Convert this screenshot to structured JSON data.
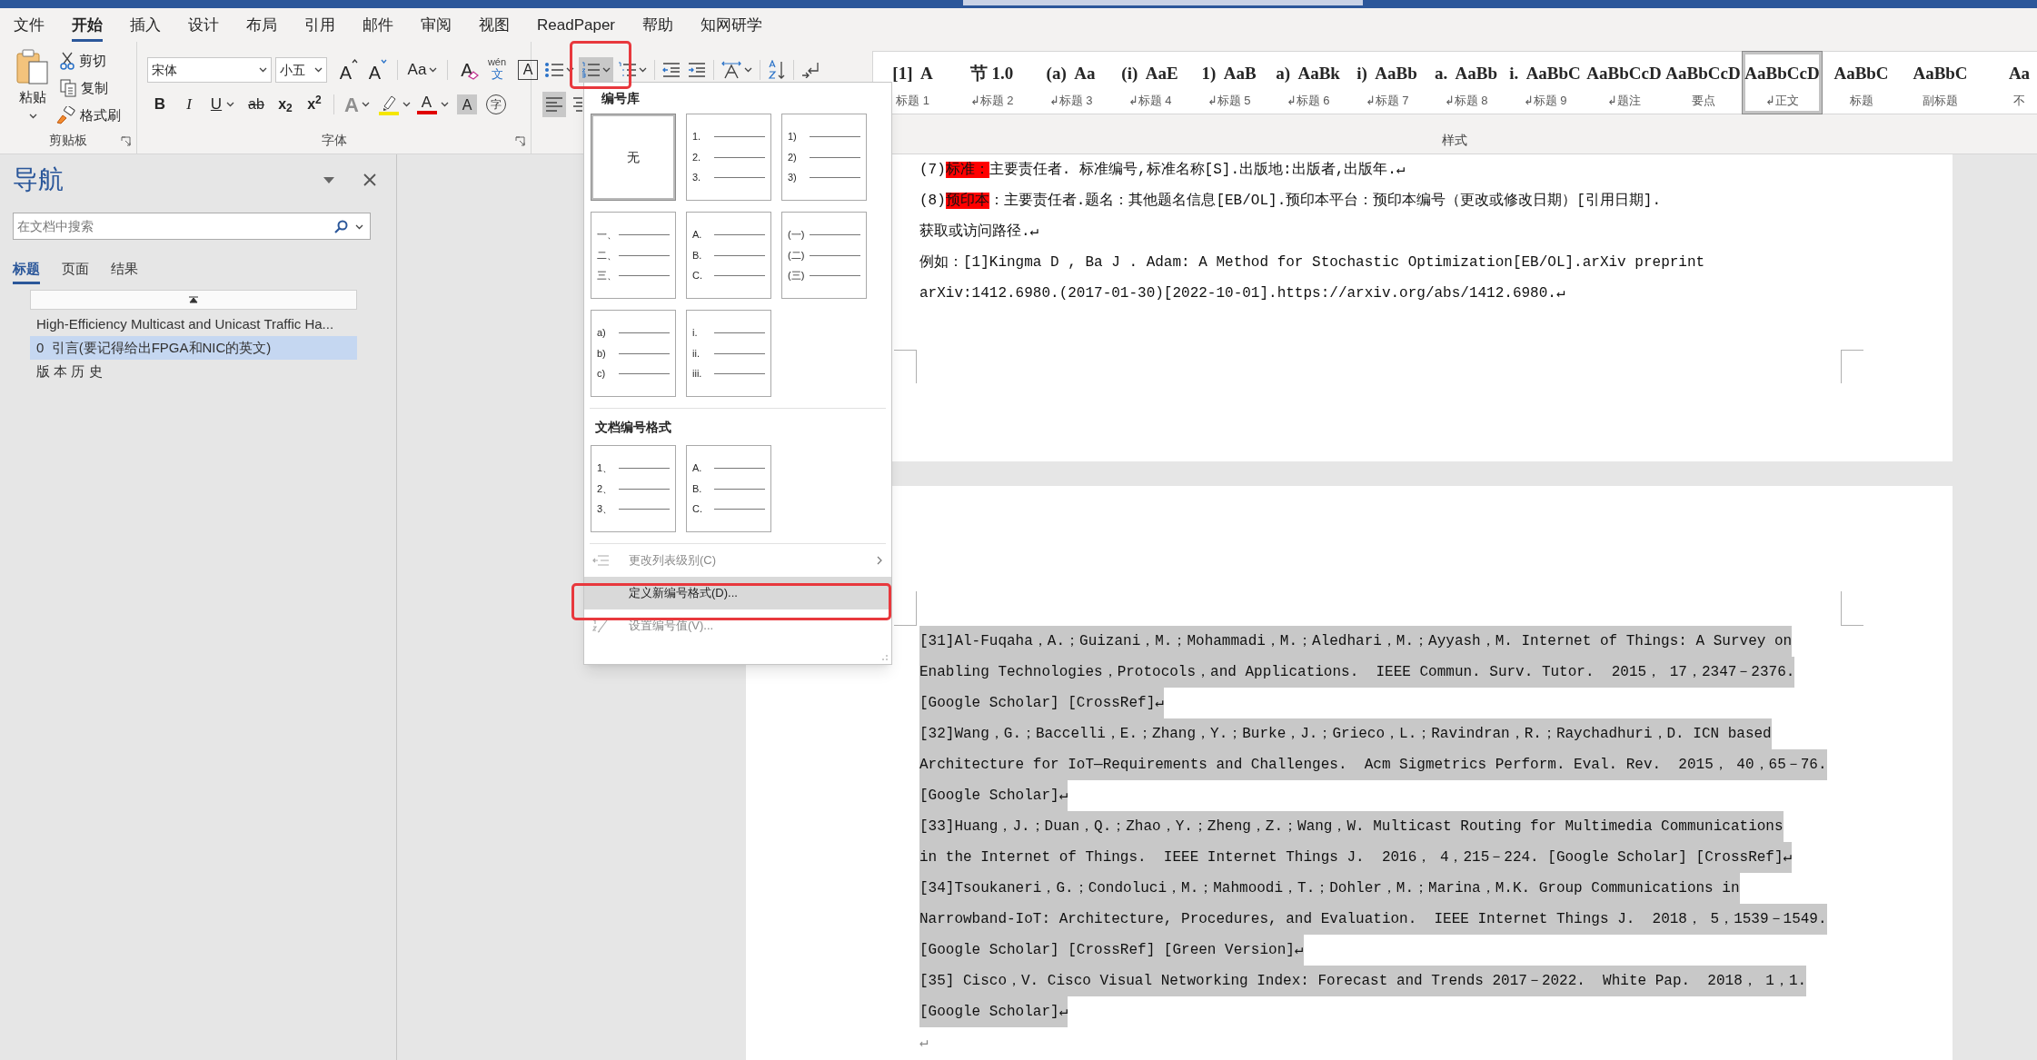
{
  "menu_tabs": [
    {
      "label": "文件",
      "selected": false
    },
    {
      "label": "开始",
      "selected": true
    },
    {
      "label": "插入",
      "selected": false
    },
    {
      "label": "设计",
      "selected": false
    },
    {
      "label": "布局",
      "selected": false
    },
    {
      "label": "引用",
      "selected": false
    },
    {
      "label": "邮件",
      "selected": false
    },
    {
      "label": "审阅",
      "selected": false
    },
    {
      "label": "视图",
      "selected": false
    },
    {
      "label": "ReadPaper",
      "selected": false
    },
    {
      "label": "帮助",
      "selected": false
    },
    {
      "label": "知网研学",
      "selected": false
    }
  ],
  "clipboard": {
    "paste": "粘贴",
    "cut": "剪切",
    "copy": "复制",
    "format_painter": "格式刷",
    "group_label": "剪贴板"
  },
  "font": {
    "font_name": "宋体",
    "font_size": "小五",
    "group_label": "字体",
    "row1": [
      {
        "kind": "grow",
        "glyph": "A"
      },
      {
        "kind": "shrink",
        "glyph": "A"
      },
      {
        "kind": "case",
        "glyph": "Aa"
      },
      {
        "kind": "clear",
        "glyph": "A"
      },
      {
        "kind": "phonetic",
        "glyph": "wén",
        "sub": "文"
      },
      {
        "kind": "border",
        "glyph": "A"
      }
    ],
    "row2": [
      {
        "kind": "bold",
        "glyph": "B"
      },
      {
        "kind": "italic",
        "glyph": "I"
      },
      {
        "kind": "underline",
        "glyph": "U"
      },
      {
        "kind": "strike",
        "glyph": "ab"
      },
      {
        "kind": "script",
        "glyph": "x$_{2}$"
      },
      {
        "kind": "script",
        "glyph": "x$^{2}$"
      },
      {
        "kind": "effects",
        "glyph": "A"
      },
      {
        "kind": "highlight"
      },
      {
        "kind": "color",
        "glyph": "A"
      },
      {
        "kind": "shading",
        "glyph": "A"
      },
      {
        "kind": "enclose",
        "glyph": "字"
      }
    ]
  },
  "paragraph": {
    "row1": [
      {
        "kind": "bullets",
        "selected": false
      },
      {
        "kind": "numbering",
        "selected": true
      },
      {
        "kind": "multilevel",
        "selected": false
      },
      {
        "kind": "outdent",
        "selected": false
      },
      {
        "kind": "indent",
        "selected": false
      },
      {
        "kind": "direction",
        "selected": false
      },
      {
        "kind": "sort",
        "selected": false
      },
      {
        "kind": "marks",
        "selected": false
      }
    ],
    "row2": [
      {
        "kind": "align_left",
        "selected": true
      },
      {
        "kind": "align_center",
        "selected": false
      }
    ]
  },
  "styles": {
    "group_label": "样式",
    "items": [
      {
        "preview": "[1]  A",
        "label": "标题 1",
        "selected": false
      },
      {
        "preview": "节 1.0",
        "label": "↲标题 2",
        "selected": false
      },
      {
        "preview": "(a)  Aa",
        "label": "↲标题 3",
        "selected": false
      },
      {
        "preview": "(i)  AaE",
        "label": "↲标题 4",
        "selected": false
      },
      {
        "preview": "1)  AaB",
        "label": "↲标题 5",
        "selected": false
      },
      {
        "preview": "a)  AaBk",
        "label": "↲标题 6",
        "selected": false
      },
      {
        "preview": "i)  AaBb",
        "label": "↲标题 7",
        "selected": false
      },
      {
        "preview": "a.  AaBb",
        "label": "↲标题 8",
        "selected": false
      },
      {
        "preview": "i.  AaBbC",
        "label": "↲标题 9",
        "selected": false
      },
      {
        "preview": "AaBbCcD",
        "label": "↲题注",
        "selected": false
      },
      {
        "preview": "AaBbCcD",
        "label": "要点",
        "selected": false
      },
      {
        "preview": "AaBbCcD",
        "label": "↲正文",
        "selected": true
      },
      {
        "preview": "AaBbC",
        "label": "标题",
        "selected": false
      },
      {
        "preview": "AaBbC",
        "label": "副标题",
        "selected": false
      },
      {
        "preview": "Aa",
        "label": "不",
        "selected": false
      }
    ]
  },
  "navigation": {
    "title": "导航",
    "search": {
      "placeholder": "在文档中搜索"
    },
    "tabs": [
      {
        "label": "标题",
        "selected": true
      },
      {
        "label": "页面",
        "selected": false
      },
      {
        "label": "结果",
        "selected": false
      }
    ],
    "headings": [
      {
        "label": "High-Efficiency Multicast and Unicast Traffic Ha...",
        "selected": false
      },
      {
        "label": "0  引言(要记得给出FPGA和NIC的英文)",
        "selected": true
      },
      {
        "label": "版 本 历 史",
        "selected": false
      }
    ]
  },
  "numbering_menu": {
    "library_title": "编号库",
    "library": [
      {
        "kind": "none",
        "label": "无",
        "selected": true
      },
      {
        "kind": "list",
        "labels": [
          "1.",
          "2.",
          "3."
        ],
        "selected": false
      },
      {
        "kind": "list",
        "labels": [
          "1)",
          "2)",
          "3)"
        ],
        "selected": false
      },
      {
        "kind": "list",
        "labels": [
          "一、",
          "二、",
          "三、"
        ],
        "selected": false
      },
      {
        "kind": "list",
        "labels": [
          "A.",
          "B.",
          "C."
        ],
        "selected": false
      },
      {
        "kind": "list",
        "labels": [
          "(一)",
          "(二)",
          "(三)"
        ],
        "selected": false
      },
      {
        "kind": "list",
        "labels": [
          "a)",
          "b)",
          "c)"
        ],
        "selected": false
      },
      {
        "kind": "list",
        "labels": [
          "i.",
          "ii.",
          "iii."
        ],
        "selected": false
      }
    ],
    "document_title": "文档编号格式",
    "document_formats": [
      {
        "kind": "list",
        "labels": [
          "1、",
          "2、",
          "3、"
        ],
        "selected": false
      },
      {
        "kind": "list",
        "labels": [
          "A.",
          "B.",
          "C."
        ],
        "selected": false
      }
    ],
    "commands": [
      {
        "kind": "level",
        "label": "更改列表级别(C)",
        "disabled": true,
        "highlighted": false,
        "submenu": true
      },
      {
        "kind": "define",
        "label": "定义新编号格式(D)...",
        "disabled": false,
        "highlighted": true,
        "submenu": false
      },
      {
        "kind": "value",
        "label": "设置编号值(V)...",
        "disabled": true,
        "highlighted": false,
        "submenu": false
      }
    ]
  },
  "document": {
    "page_1": [
      {
        "kind": "entry",
        "number": "(7)",
        "tag": "标准：",
        "text": "主要责任者. 标准编号,标准名称[S].出版地:出版者,出版年.↵"
      },
      {
        "kind": "entry",
        "number": "(8)",
        "tag": "预印本",
        "text": "：主要责任者.题名：其他题名信息[EB/OL].预印本平台：预印本编号（更改或修改日期）[引用日期]."
      },
      {
        "kind": "plain",
        "text": "获取或访问路径.↵"
      },
      {
        "kind": "plain",
        "text": "例如：[1]Kingma D , Ba J . Adam: A Method for Stochastic Optimization[EB/OL].arXiv preprint"
      },
      {
        "kind": "plain",
        "text": "arXiv:1412.6980.(2017-01-30)[2022-10-01].https://arxiv.org/abs/1412.6980.↵"
      }
    ],
    "page_2": [
      {
        "text": "[31]Al-Fuqaha，A.；Guizani，M.；Mohammadi，M.；Aledhari，M.；Ayyash，M. Internet of Things: A Survey on",
        "selected": true
      },
      {
        "text": "Enabling Technologies，Protocols，and Applications.  IEEE Commun. Surv. Tutor.  2015， 17，2347－2376.",
        "selected": true
      },
      {
        "text": "[Google Scholar] [CrossRef]↵",
        "selected": true
      },
      {
        "text": "[32]Wang，G.；Baccelli，E.；Zhang，Y.；Burke，J.；Grieco，L.；Ravindran，R.；Raychadhuri，D. ICN based",
        "selected": true
      },
      {
        "text": "Architecture for IoT—Requirements and Challenges.  Acm Sigmetrics Perform. Eval. Rev.  2015， 40，65－76.",
        "selected": true
      },
      {
        "text": "[Google Scholar]↵",
        "selected": true
      },
      {
        "text": "[33]Huang，J.；Duan，Q.；Zhao，Y.；Zheng，Z.；Wang，W. Multicast Routing for Multimedia Communications",
        "selected": true
      },
      {
        "text": "in the Internet of Things.  IEEE Internet Things J.  2016， 4，215－224. [Google Scholar] [CrossRef]↵",
        "selected": true
      },
      {
        "text": "[34]Tsoukaneri，G.；Condoluci，M.；Mahmoodi，T.；Dohler，M.；Marina，M.K. Group Communications in",
        "selected": true
      },
      {
        "text": "Narrowband-IoT: Architecture, Procedures, and Evaluation.  IEEE Internet Things J.  2018， 5，1539－1549.",
        "selected": true
      },
      {
        "text": "[Google Scholar] [CrossRef] [Green Version]↵",
        "selected": true
      },
      {
        "text": "[35] Cisco，V. Cisco Visual Networking Index: Forecast and Trends 2017－2022.  White Pap.  2018， 1，1.",
        "selected": true
      },
      {
        "text": "[Google Scholar]↵",
        "selected": true
      },
      {
        "text": "↵",
        "selected": false
      }
    ]
  }
}
